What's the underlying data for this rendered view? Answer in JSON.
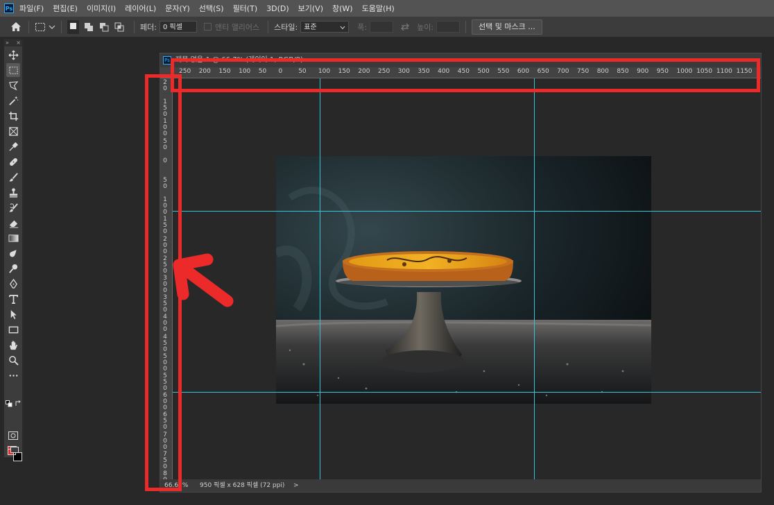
{
  "menu": {
    "items": [
      "파일(F)",
      "편집(E)",
      "이미지(I)",
      "레이어(L)",
      "문자(Y)",
      "선택(S)",
      "필터(T)",
      "3D(D)",
      "보기(V)",
      "창(W)",
      "도움말(H)"
    ]
  },
  "options": {
    "feather_label": "페더:",
    "feather_value": "0 픽셀",
    "antialias_label": "앤티 앨리어스",
    "style_label": "스타일:",
    "style_value": "표준",
    "width_label": "폭:",
    "height_label": "높이:",
    "select_mask_button": "선택 및 마스크 ..."
  },
  "document": {
    "tab_title": "제목 없음-1 @ 66.7% (레이어 1, RGB/8)",
    "zoom": "66.67%",
    "doc_info": "950 픽셀 x 628 픽셀 (72 ppi)",
    "status_arrow": ">"
  },
  "rulers": {
    "horizontal": [
      "250",
      "200",
      "150",
      "100",
      "50",
      "0",
      "50",
      "100",
      "150",
      "200",
      "250",
      "300",
      "350",
      "400",
      "450",
      "500",
      "550",
      "600",
      "650",
      "700",
      "750",
      "800",
      "850",
      "900",
      "950",
      "1000",
      "1050",
      "1100",
      "1150"
    ],
    "vertical": [
      "2 0",
      "1 5 0",
      "1 0 0",
      "5 0",
      "0",
      "5 0",
      "1 0 0",
      "1 5 0",
      "2 0 0",
      "2 5 0",
      "3 0 0",
      "3 5 0",
      "4 0 0",
      "4 5 0",
      "5 0 0",
      "5 5 0",
      "6 0 0",
      "6 5 0",
      "7 0 0",
      "7 5 0",
      "8 0 0"
    ]
  },
  "colors": {
    "foreground": "#ea2a2a",
    "background": "#000000",
    "guide": "#35c7d9",
    "annotation": "#ec2a2a"
  },
  "tools": [
    "move-tool",
    "marquee-tool",
    "lasso-tool",
    "magic-wand-tool",
    "crop-tool",
    "frame-tool",
    "eyedropper-tool",
    "healing-brush-tool",
    "brush-tool",
    "clone-stamp-tool",
    "history-brush-tool",
    "eraser-tool",
    "gradient-tool",
    "blur-tool",
    "dodge-tool",
    "pen-tool",
    "type-tool",
    "path-selection-tool",
    "rectangle-tool",
    "hand-tool",
    "zoom-tool",
    "more-tools"
  ]
}
